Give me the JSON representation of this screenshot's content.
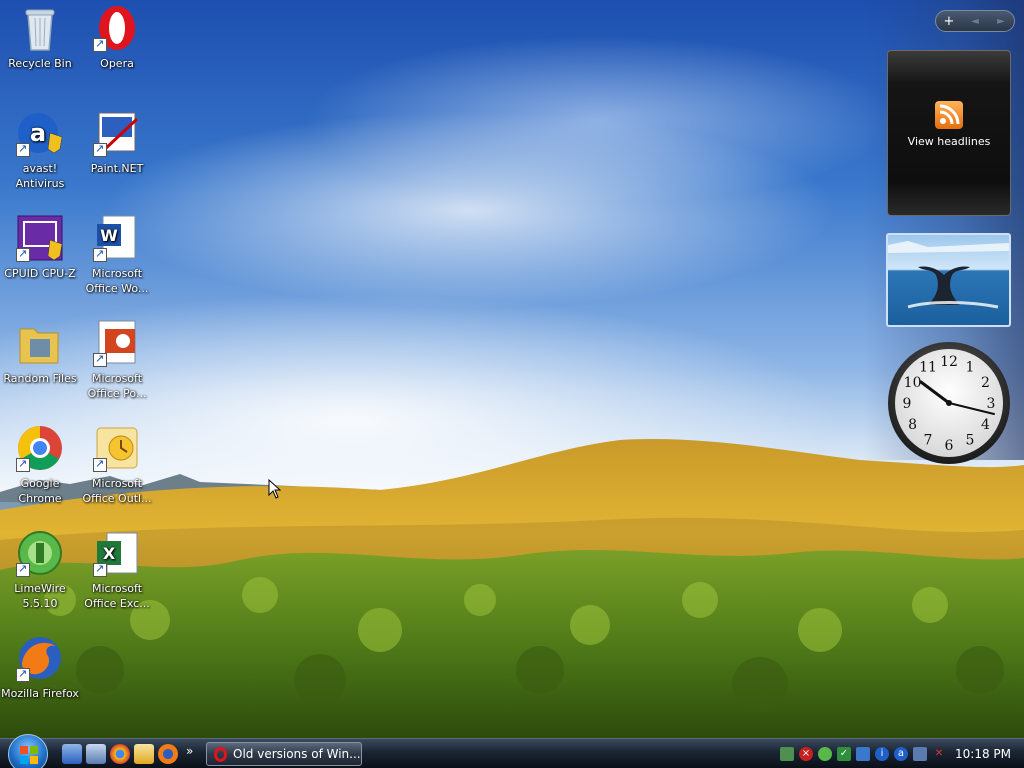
{
  "desktop": {
    "icons": [
      {
        "name": "recycle-bin",
        "label": "Recycle Bin"
      },
      {
        "name": "opera",
        "label": "Opera"
      },
      {
        "name": "avast",
        "label": "avast! Antivirus"
      },
      {
        "name": "paint-net",
        "label": "Paint.NET"
      },
      {
        "name": "cpu-z",
        "label": "CPUID CPU-Z"
      },
      {
        "name": "office-word",
        "label": "Microsoft Office Wo..."
      },
      {
        "name": "random-files",
        "label": "Random Files"
      },
      {
        "name": "office-powerpoint",
        "label": "Microsoft Office Po..."
      },
      {
        "name": "google-chrome",
        "label": "Google Chrome"
      },
      {
        "name": "office-outlook",
        "label": "Microsoft Office Outl..."
      },
      {
        "name": "limewire",
        "label": "LimeWire 5.5.10"
      },
      {
        "name": "office-excel",
        "label": "Microsoft Office Exc..."
      },
      {
        "name": "mozilla-firefox",
        "label": "Mozilla Firefox"
      }
    ]
  },
  "sidebar": {
    "controls": {
      "add": "+",
      "prev": "◄",
      "next": "►"
    },
    "feed_gadget": {
      "label": "View headlines"
    },
    "clock_numbers": [
      "12",
      "1",
      "2",
      "3",
      "4",
      "5",
      "6",
      "7",
      "8",
      "9",
      "10",
      "11"
    ]
  },
  "taskbar": {
    "quick_launch": [
      "show-desktop",
      "switch-windows",
      "chrome",
      "outlook",
      "firefox"
    ],
    "chevron": "»",
    "task_button_label": "Old versions of Win...",
    "time": "10:18 PM"
  },
  "colors": {
    "taskbar": "#1b2533",
    "opera_red": "#e0141e",
    "rss_orange": "#e46f0f"
  }
}
